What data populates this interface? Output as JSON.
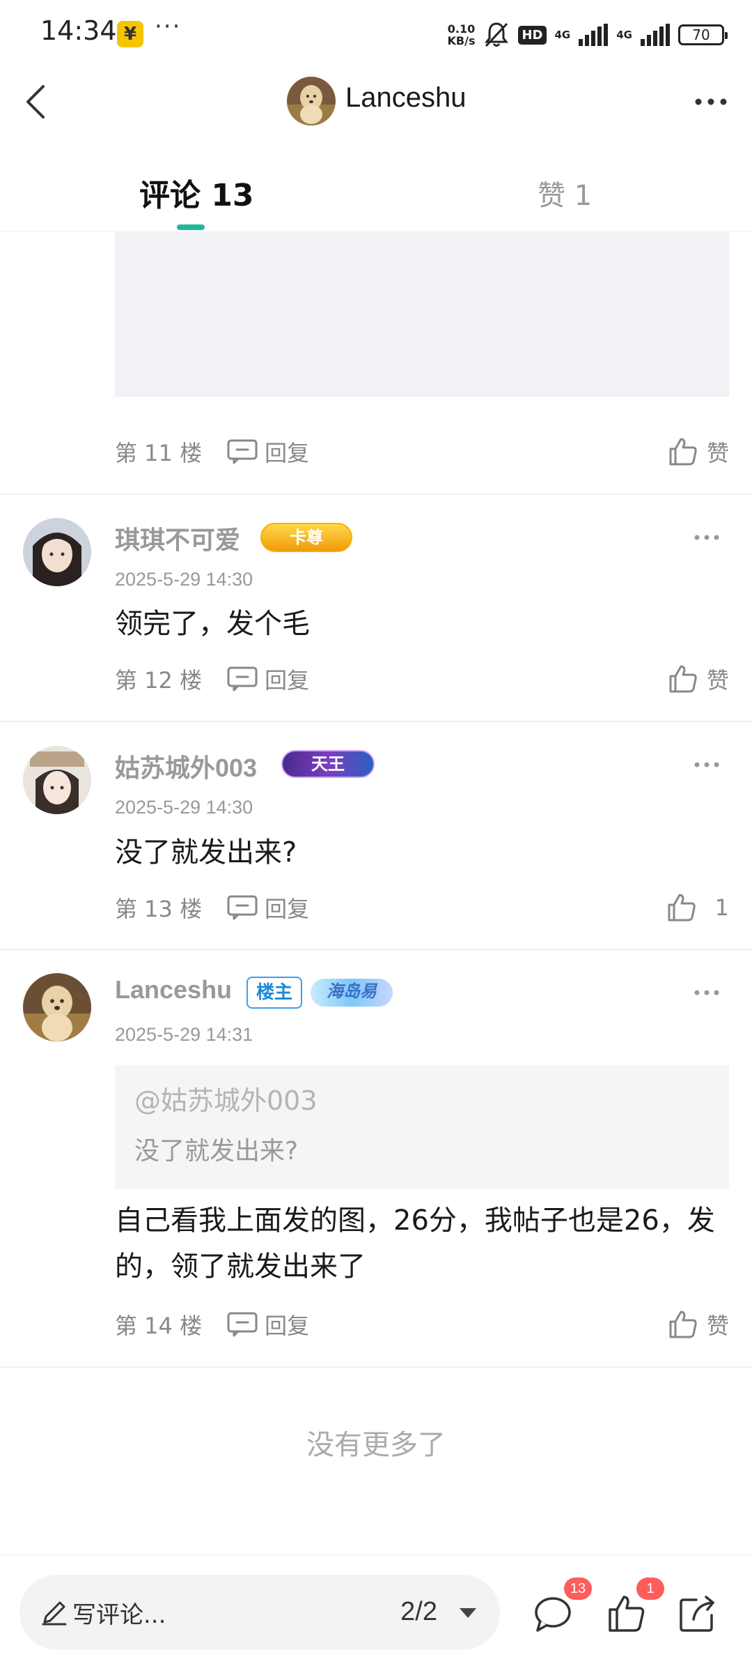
{
  "status_bar": {
    "time": "14:34",
    "pay_icon": "¥",
    "more": "···",
    "speed_value": "0.10",
    "speed_unit": "KB/s",
    "hd": "HD",
    "net1": "4G",
    "net2": "4G",
    "battery": "70"
  },
  "nav": {
    "title": "Lanceshu"
  },
  "tabs": {
    "comments": "评论 13",
    "likes": "赞 1"
  },
  "floors": [
    {
      "floor": "第 11 楼",
      "reply": "回复",
      "like": "赞"
    },
    {
      "floor": "第 12 楼",
      "reply": "回复",
      "like": "赞"
    },
    {
      "floor": "第 13 楼",
      "reply": "回复",
      "like": "1"
    },
    {
      "floor": "第 14 楼",
      "reply": "回复",
      "like": "赞"
    }
  ],
  "comments": [
    {
      "name": "琪琪不可爱",
      "badge": "卡尊",
      "time": "2025-5-29 14:30",
      "text": "领完了，发个毛"
    },
    {
      "name": "姑苏城外003",
      "badge": "天王",
      "time": "2025-5-29 14:30",
      "text": "没了就发出来?"
    },
    {
      "name": "Lanceshu",
      "owner_badge": "楼主",
      "badge": "海岛易",
      "time": "2025-5-29 14:31",
      "quote_user": "@姑苏城外003",
      "quote_text": "没了就发出来?",
      "text": "自己看我上面发的图，26分，我帖子也是26，发的，领了就发出来了"
    }
  ],
  "footer": {
    "no_more": "没有更多了"
  },
  "bottom_bar": {
    "write_label": "写评论...",
    "page": "2/2",
    "comment_count": "13",
    "like_count": "1"
  },
  "colors": {
    "accent": "#1fb89a",
    "badge_red": "#ff5c5c",
    "muted_text": "#999999"
  }
}
